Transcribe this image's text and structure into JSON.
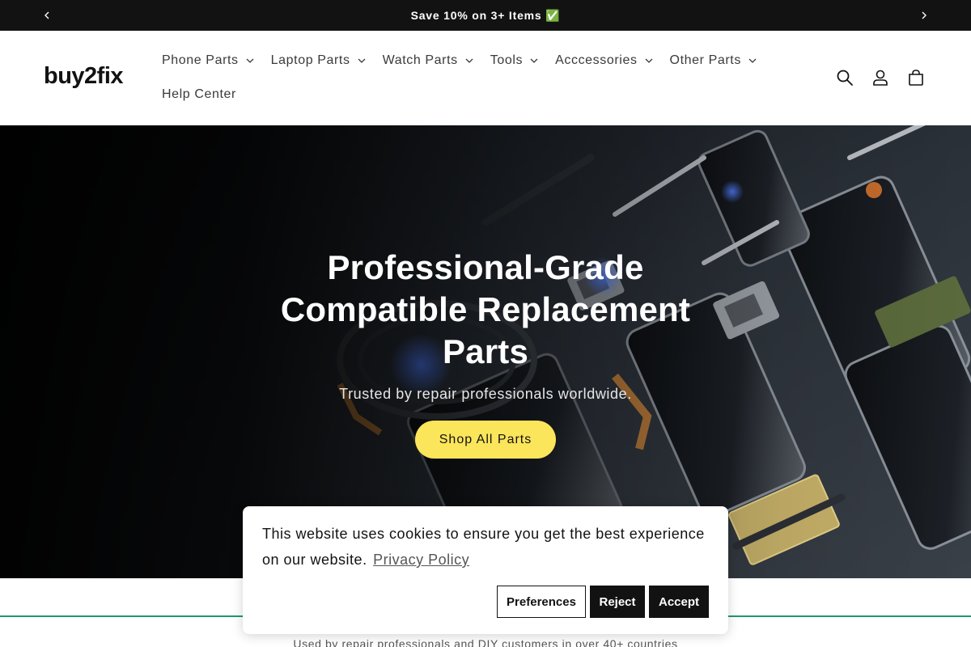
{
  "announcement": {
    "text": "Save 10% on 3+ Items ✅",
    "prev_icon": "chevron-left-icon",
    "next_icon": "chevron-right-icon"
  },
  "header": {
    "logo": "buy2fix",
    "nav": [
      {
        "label": "Phone Parts",
        "dropdown": true
      },
      {
        "label": "Laptop Parts",
        "dropdown": true
      },
      {
        "label": "Watch Parts",
        "dropdown": true
      },
      {
        "label": "Tools",
        "dropdown": true
      },
      {
        "label": "Acccessories",
        "dropdown": true
      },
      {
        "label": "Other Parts",
        "dropdown": true
      },
      {
        "label": "Help Center",
        "dropdown": false
      }
    ],
    "icons": [
      "search-icon",
      "account-icon",
      "cart-icon"
    ]
  },
  "hero": {
    "title": "Professional-Grade Compatible Replacement Parts",
    "subtitle": "Trusted by repair professionals worldwide.",
    "button": "Shop All Parts",
    "accent_color": "#fbe55a"
  },
  "below_hero": {
    "text": "Used by repair professionals and DIY customers in over 40+ countries",
    "accent_color": "#1d9b6c"
  },
  "cookie_banner": {
    "message": "This website uses cookies to ensure you get the best experience on our website.",
    "link": "Privacy Policy",
    "buttons": {
      "preferences": "Preferences",
      "reject": "Reject",
      "accept": "Accept"
    }
  }
}
